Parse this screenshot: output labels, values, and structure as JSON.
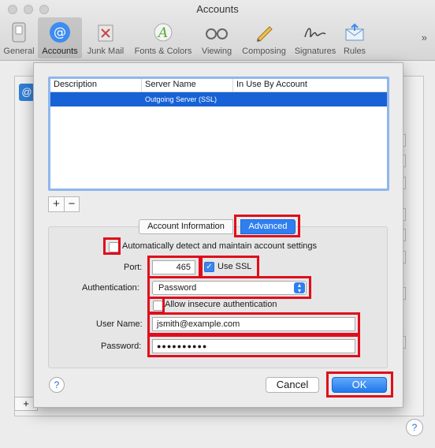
{
  "window": {
    "title": "Accounts"
  },
  "toolbar": {
    "items": [
      {
        "label": "General",
        "icon": "general-switch-icon"
      },
      {
        "label": "Accounts",
        "icon": "at-sign-icon"
      },
      {
        "label": "Junk Mail",
        "icon": "junk-trash-icon"
      },
      {
        "label": "Fonts & Colors",
        "icon": "fonts-colors-icon"
      },
      {
        "label": "Viewing",
        "icon": "glasses-icon"
      },
      {
        "label": "Composing",
        "icon": "pencil-icon"
      },
      {
        "label": "Signatures",
        "icon": "signature-icon"
      },
      {
        "label": "Rules",
        "icon": "rules-envelope-icon"
      }
    ],
    "overflow": "»"
  },
  "server_list": {
    "columns": [
      "Description",
      "Server Name",
      "In Use By Account"
    ],
    "rows": [
      {
        "description": "",
        "server_name": "Outgoing Server (SSL)",
        "in_use": ""
      }
    ],
    "add_label": "+",
    "remove_label": "−"
  },
  "tabs": {
    "info": "Account Information",
    "advanced": "Advanced"
  },
  "advanced": {
    "auto_detect_label": "Automatically detect and maintain account settings",
    "auto_detect_checked": false,
    "port_label": "Port:",
    "port_value": "465",
    "use_ssl_label": "Use SSL",
    "use_ssl_checked": true,
    "auth_label": "Authentication:",
    "auth_value": "Password",
    "insecure_label": "Allow insecure authentication",
    "insecure_checked": false,
    "username_label": "User Name:",
    "username_value": "jsmith@example.com",
    "password_label": "Password:",
    "password_value": "●●●●●●●●●●"
  },
  "buttons": {
    "help": "?",
    "cancel": "Cancel",
    "ok": "OK"
  },
  "background": {
    "plus": "+",
    "help": "?",
    "account_icon": "@"
  },
  "colors": {
    "accent": "#2f7ff0",
    "highlight": "#e00d1c",
    "selection": "#1762d6"
  }
}
